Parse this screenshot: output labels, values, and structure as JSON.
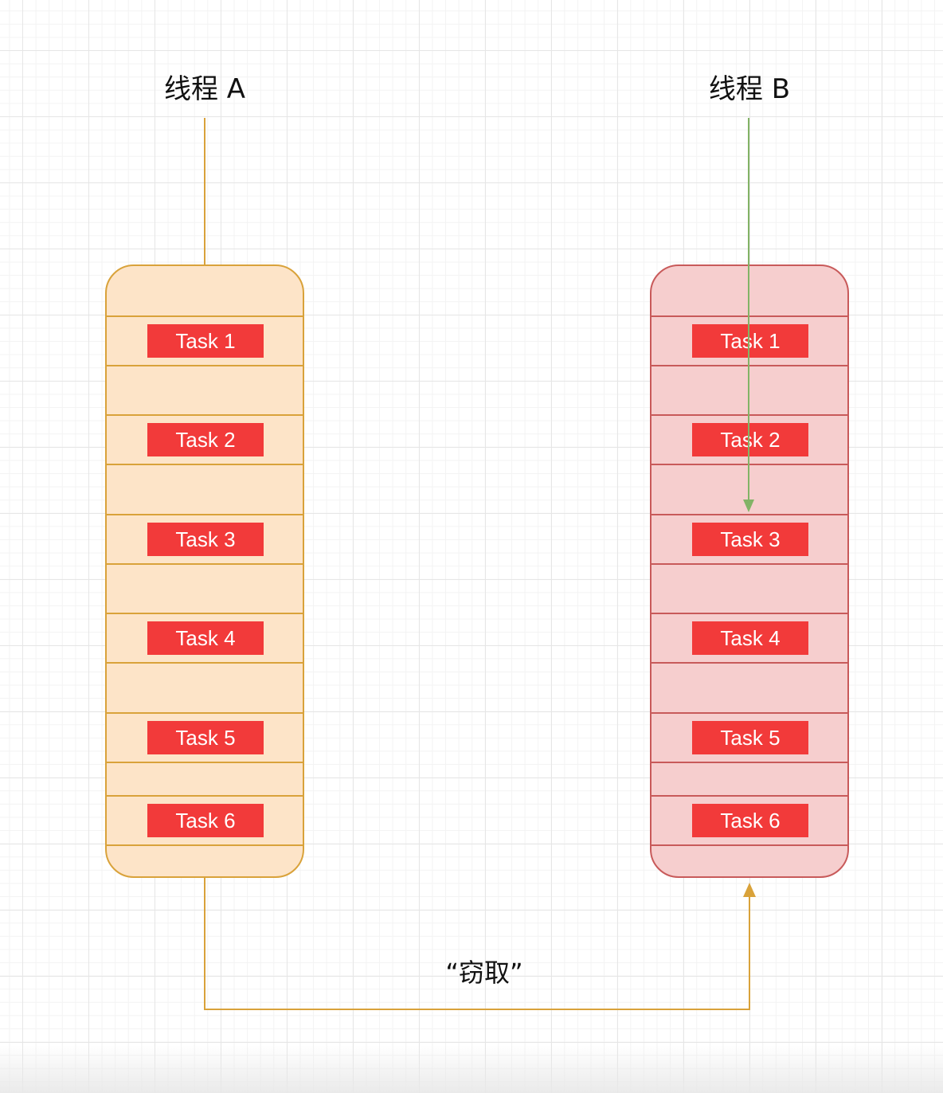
{
  "threads": [
    {
      "id": "a",
      "title": "线程 A",
      "tasks": [
        "Task 1",
        "Task 2",
        "Task 3",
        "Task 4",
        "Task 5",
        "Task 6"
      ]
    },
    {
      "id": "b",
      "title": "线程 B",
      "tasks": [
        "Task 1",
        "Task 2",
        "Task 3",
        "Task 4",
        "Task 5",
        "Task 6"
      ]
    }
  ],
  "steal_label": "“窃取”",
  "colors": {
    "queue_a_fill": "#fde4c8",
    "queue_a_border": "#d9a23a",
    "queue_b_fill": "#f6cece",
    "queue_b_border": "#c85a5a",
    "task_fill": "#f23a3a",
    "thread_b_arrow": "#82b366",
    "steal_arrow": "#d9a23a"
  }
}
